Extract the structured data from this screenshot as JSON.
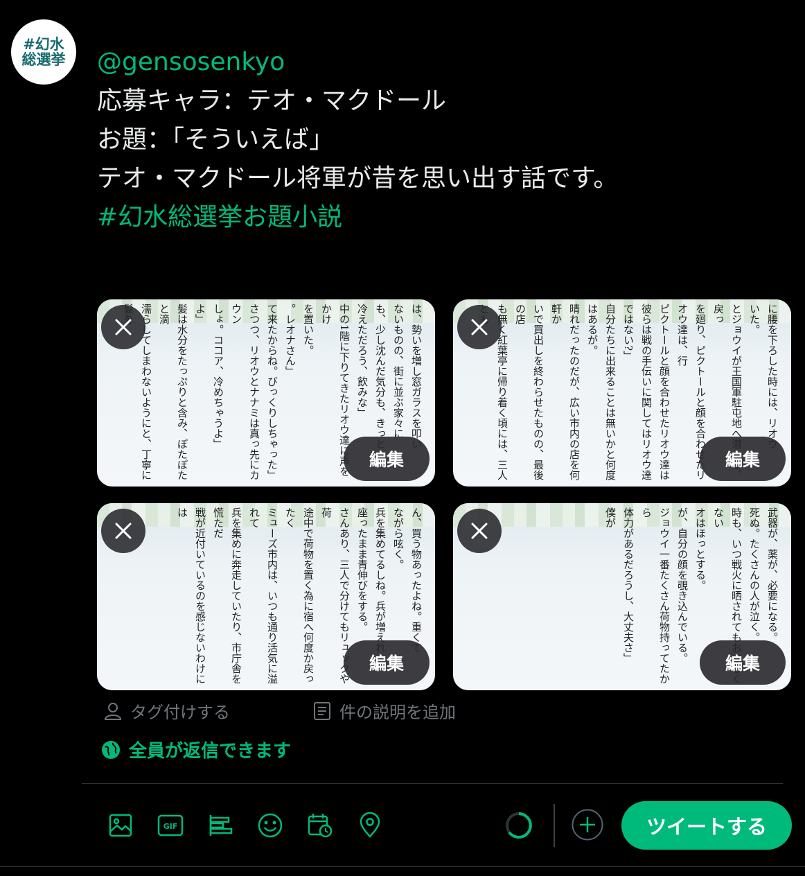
{
  "avatar": {
    "line1": "#幻水",
    "line2": "総選挙"
  },
  "tweet": {
    "handle": "@gensosenkyo",
    "line1": "応募キャラ：テオ・マクドール",
    "line2": "お題：「そういえば」",
    "line3": "テオ・マクドール将軍が昔を思い出す話です。",
    "hashtag": "#幻水総選挙お題小説"
  },
  "media": [
    {
      "edit_label": "編集",
      "text": "は、勢いを増し窓ガラスを叩い\nないものの、街に並ぶ家々に\nも、少し沈んだ気分も、きっと\n冷えただろう、飲みな」\n中の1階に下りてきたリオウ達に声をかけ\nを置いた。\n。レオナさん」\nて来たからね。びっくりしちゃった」\nさつつ、リオウとナナミは真っ先にカウン\nしょ。ココア、冷めちゃうよ」\nよ」\n髪は水分をたっぷりと含み、ぽたぽたと滴\n濡らしてしまわないようにと、丁寧に髪を\n人より幾らか遅い。"
    },
    {
      "edit_label": "編集",
      "text": "に腰を下ろした時には、リオウ\nいた。\nとジョウイが王国軍駐屯地へ潜入し、戻っ\nを廻り、ピクトールと顔を合わせたリオウ達は、行\nピクトールと顔を合わせたリオウ達は\n彼らは戦の手伝いに関してはリオウ達ではない?」\n自分たちに出来ることは無いかと何度\nはあるが。\n晴れだったのだが、広い市内の店を何軒か\nいで買出しを終わらせたものの、最後の店\nも無く紅葉亭に帰り着く頃には、三人とも"
    },
    {
      "edit_label": "編集",
      "text": "ん、買う物あったよね。重くて\nながら呟く。\n兵を集めてるしね。兵が増えれ\n座ったまま青伸びをする。\nさんあり、三人で分けてもリュックや荷\n途中で荷物を置く為に宿へ何度か戻ったく\nミューズ市内は、いつも通り活気に溢れて\n兵を集めに奔走していたり、市庁舎を慌ただ\n戦が近付いているのを感じないわけには"
    },
    {
      "edit_label": "編集",
      "text": "武器が、薬が、必要になる。\n死ぬ。たくさんの人が泣く。\n時も、いつ戦火に晒されてもおかしくない\nオはほっとする。\nが、自分の顔を覗き込んでいる。\nジョウイ一番たくさん荷物持ってたから\n体力があるだろうし、大丈夫さ」\n僕が"
    }
  ],
  "tag_people": "タグ付けする",
  "add_description": "件の説明を追加",
  "reply_setting": "全員が返信できます",
  "toolbar_icons": [
    "image-icon",
    "gif-icon",
    "poll-icon",
    "emoji-icon",
    "schedule-icon",
    "location-icon"
  ],
  "gif_label": "GIF",
  "tweet_button": "ツイートする",
  "colors": {
    "accent": "#00ba7c",
    "muted": "#71767b",
    "background": "#000000"
  }
}
